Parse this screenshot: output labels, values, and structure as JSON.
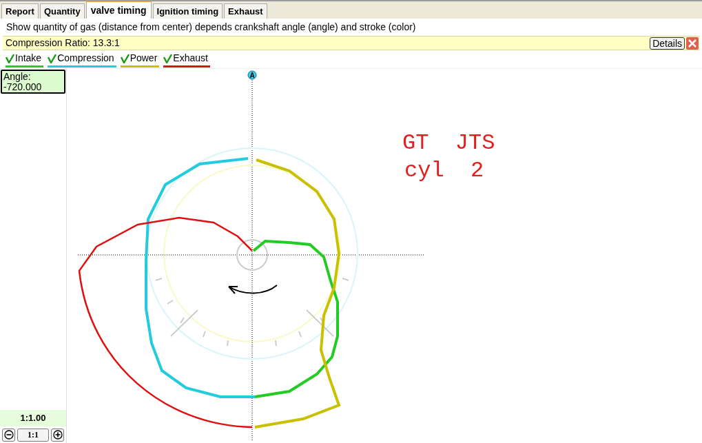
{
  "tabs": [
    {
      "label": "Report",
      "selected": false
    },
    {
      "label": "Quantity",
      "selected": false
    },
    {
      "label": "valve timing",
      "selected": true
    },
    {
      "label": "Ignition timing",
      "selected": false
    },
    {
      "label": "Exhaust",
      "selected": false
    }
  ],
  "description": "Show quantity of gas (distance from center) depends crankshaft angle (angle) and stroke (color)",
  "info_bar": {
    "text": "Compression Ratio: 13.3:1",
    "details_button": "Details"
  },
  "legend": [
    {
      "label": "Intake",
      "checked": true,
      "color": "#22cc22"
    },
    {
      "label": "Compression",
      "checked": true,
      "color": "#22ccdd"
    },
    {
      "label": "Power",
      "checked": true,
      "color": "#c8c000"
    },
    {
      "label": "Exhaust",
      "checked": true,
      "color": "#dd1111"
    }
  ],
  "angle_box": {
    "label": "Angle:",
    "value": "-720.000"
  },
  "zoom": {
    "ratio": "1:1.00",
    "reset_button": "1:1"
  },
  "plot": {
    "axis_marker": "A",
    "annotation_lines": [
      "GT  JTS",
      "cyl  2"
    ]
  }
}
